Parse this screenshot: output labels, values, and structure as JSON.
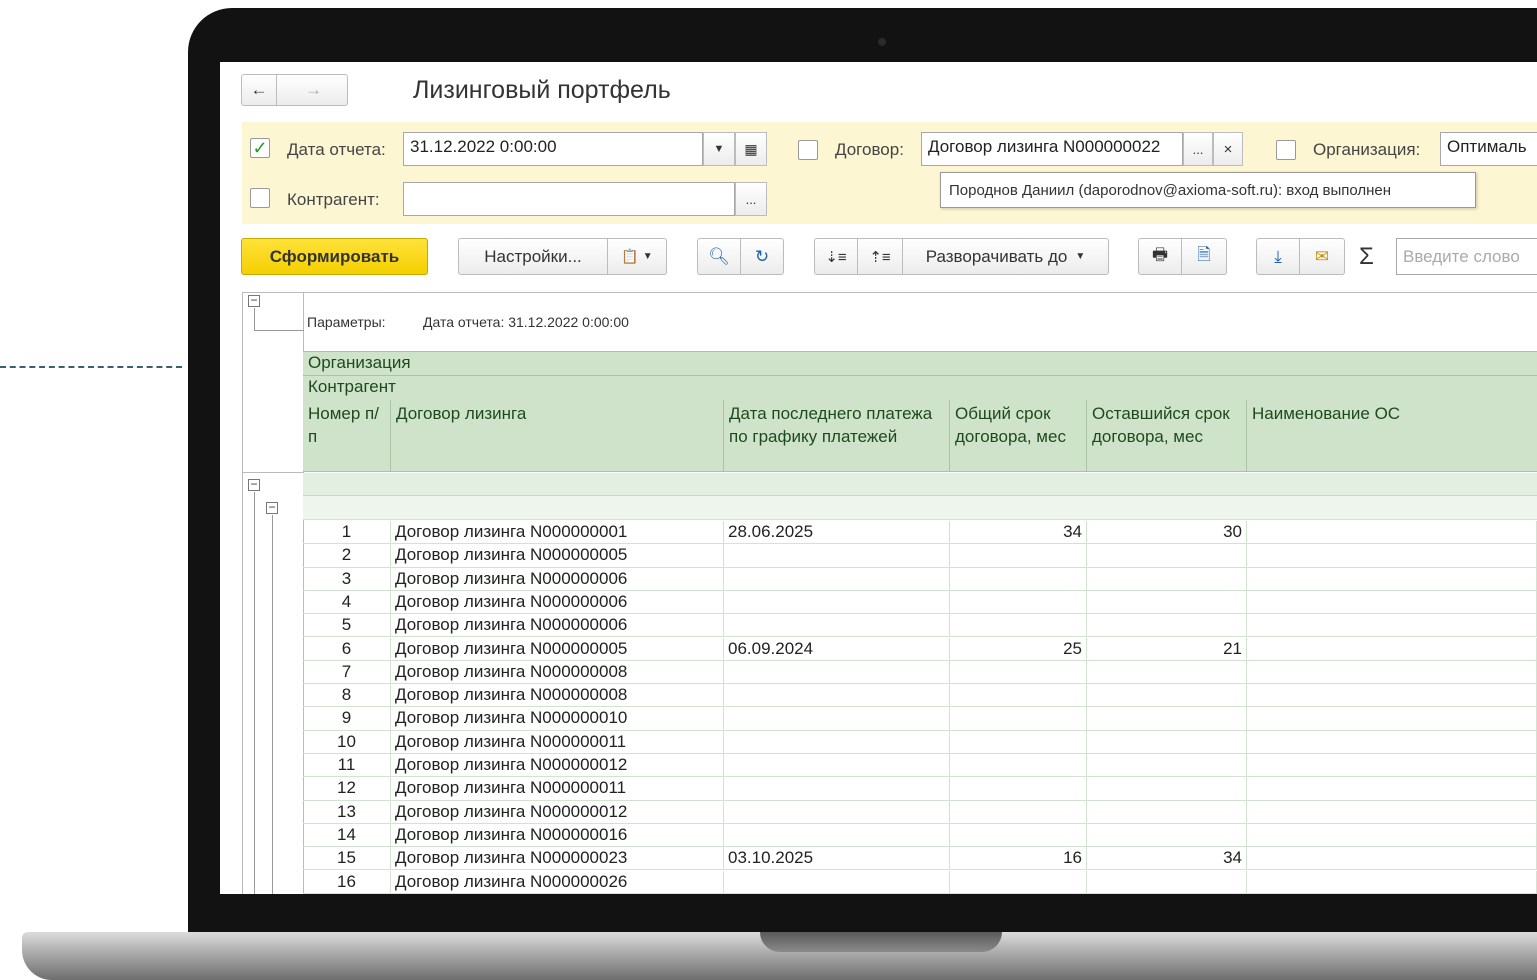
{
  "window": {
    "title": "Лизинговый портфель"
  },
  "filters": {
    "report_date_label": "Дата отчета:",
    "report_date_checked": "✓",
    "report_date_value": "31.12.2022  0:00:00",
    "contract_label": "Договор:",
    "contract_value": "Договор лизинга N000000022",
    "org_label": "Организация:",
    "org_value": "Оптималь",
    "counterparty_label": "Контрагент:",
    "counterparty_value": "",
    "tooltip": "Породнов Даниил (daporodnov@axioma-soft.ru): вход выполнен",
    "ellipsis": "...",
    "clear": "×"
  },
  "toolbar": {
    "generate": "Сформировать",
    "settings": "Настройки...",
    "expand_to": "Разворачивать до",
    "sigma": "Σ",
    "search_placeholder": "Введите слово"
  },
  "report": {
    "params_label": "Параметры:",
    "params_value": "Дата отчета: 31.12.2022 0:00:00",
    "group1": "Организация",
    "group2": "Контрагент",
    "columns": [
      "Номер п/п",
      "Договор лизинга",
      "Дата последнего платежа по графику платежей",
      "Общий срок договора, мес",
      "Оставшийся срок договора, мес",
      "Наименование ОС"
    ],
    "rows": [
      {
        "n": "1",
        "contract": "Договор лизинга N000000001",
        "date": "28.06.2025",
        "total": "34",
        "left": "30"
      },
      {
        "n": "2",
        "contract": "Договор лизинга N000000005",
        "date": "",
        "total": "",
        "left": ""
      },
      {
        "n": "3",
        "contract": "Договор лизинга N000000006",
        "date": "",
        "total": "",
        "left": ""
      },
      {
        "n": "4",
        "contract": "Договор лизинга N000000006",
        "date": "",
        "total": "",
        "left": ""
      },
      {
        "n": "5",
        "contract": "Договор лизинга N000000006",
        "date": "",
        "total": "",
        "left": ""
      },
      {
        "n": "6",
        "contract": "Договор лизинга N000000005",
        "date": "06.09.2024",
        "total": "25",
        "left": "21"
      },
      {
        "n": "7",
        "contract": "Договор лизинга N000000008",
        "date": "",
        "total": "",
        "left": ""
      },
      {
        "n": "8",
        "contract": "Договор лизинга N000000008",
        "date": "",
        "total": "",
        "left": ""
      },
      {
        "n": "9",
        "contract": "Договор лизинга N000000010",
        "date": "",
        "total": "",
        "left": ""
      },
      {
        "n": "10",
        "contract": "Договор лизинга N000000011",
        "date": "",
        "total": "",
        "left": ""
      },
      {
        "n": "11",
        "contract": "Договор лизинга N000000012",
        "date": "",
        "total": "",
        "left": ""
      },
      {
        "n": "12",
        "contract": "Договор лизинга N000000011",
        "date": "",
        "total": "",
        "left": ""
      },
      {
        "n": "13",
        "contract": "Договор лизинга N000000012",
        "date": "",
        "total": "",
        "left": ""
      },
      {
        "n": "14",
        "contract": "Договор лизинга N000000016",
        "date": "",
        "total": "",
        "left": ""
      },
      {
        "n": "15",
        "contract": "Договор лизинга N000000023",
        "date": "03.10.2025",
        "total": "16",
        "left": "34"
      },
      {
        "n": "16",
        "contract": "Договор лизинга N000000026",
        "date": "",
        "total": "",
        "left": ""
      }
    ]
  }
}
